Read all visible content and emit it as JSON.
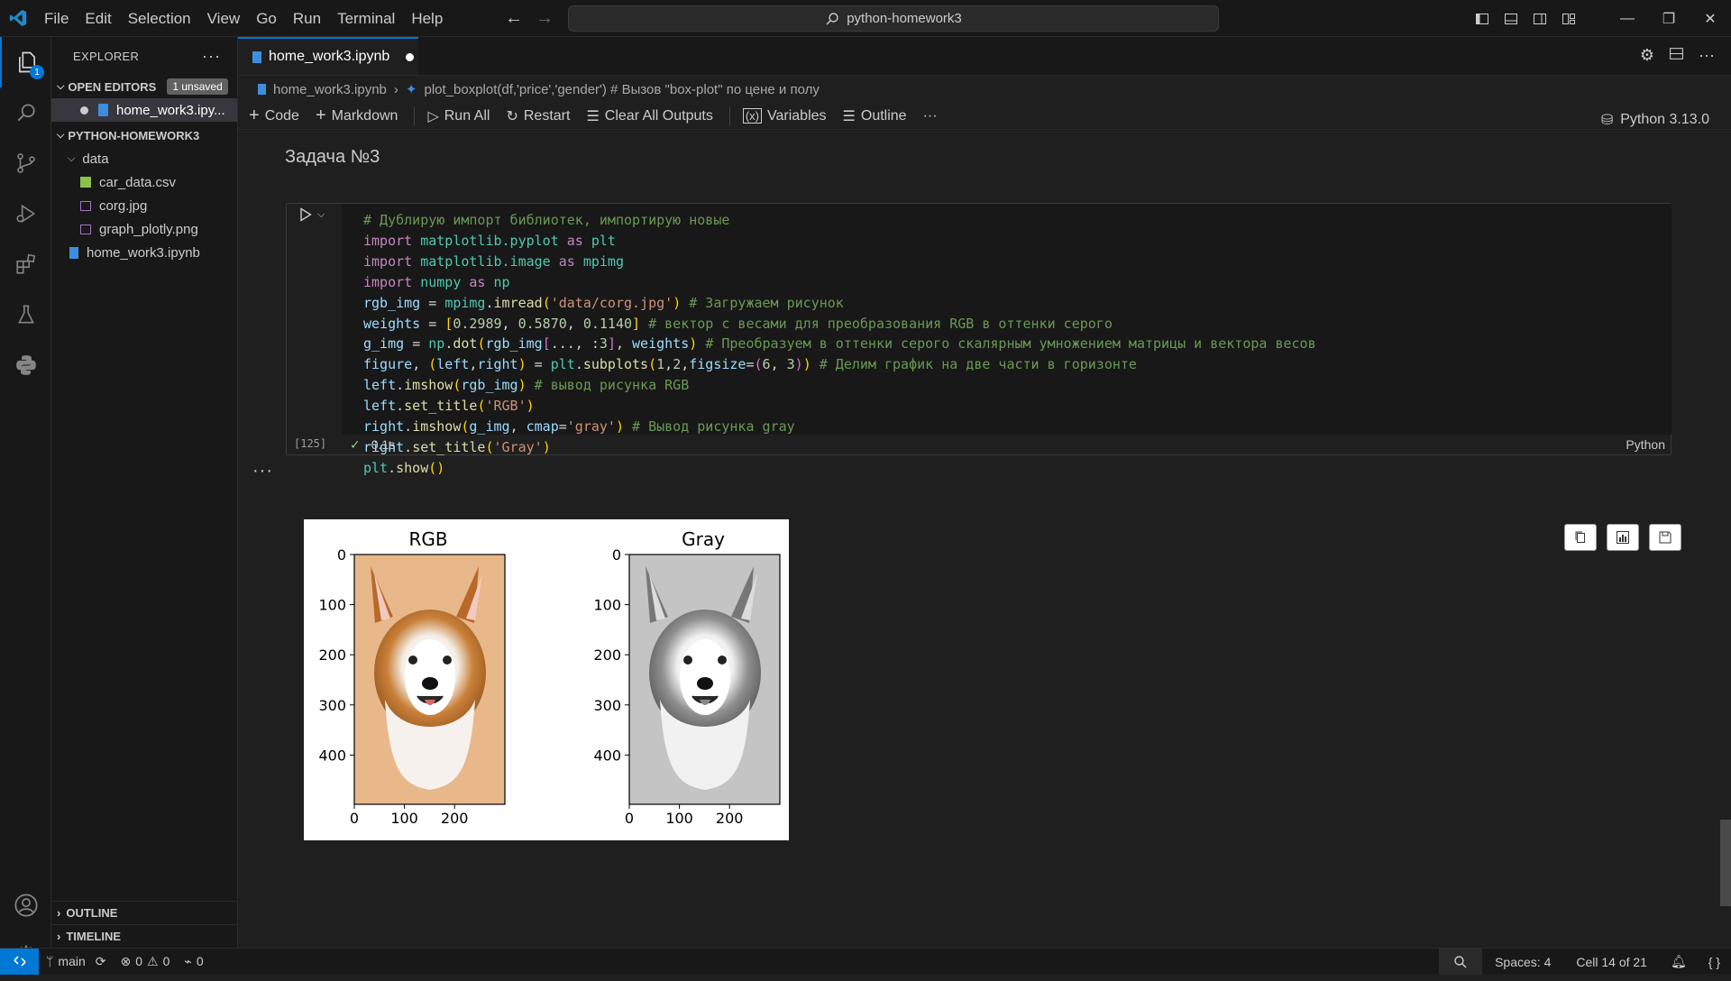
{
  "colors": {
    "accent": "#0078d4",
    "background": "#1f1f1f",
    "sidebar": "#181818",
    "figure_face": "#ffffff"
  },
  "menu": [
    "File",
    "Edit",
    "Selection",
    "View",
    "Go",
    "Run",
    "Terminal",
    "Help"
  ],
  "command_center": {
    "text": "python-homework3"
  },
  "activity_bar": {
    "items": [
      "explorer-icon",
      "search-icon",
      "source-control-icon",
      "run-debug-icon",
      "extensions-icon",
      "testing-icon",
      "python-icon"
    ],
    "explorer_badge": "1",
    "bottom": [
      "accounts-icon",
      "manage-icon"
    ]
  },
  "explorer": {
    "title": "EXPLORER",
    "open_editors": {
      "label": "OPEN EDITORS",
      "badge": "1 unsaved",
      "files": [
        "home_work3.ipy..."
      ]
    },
    "folder": {
      "label": "PYTHON-HOMEWORK3",
      "subfolder": "data",
      "data_files": [
        "car_data.csv",
        "corg.jpg",
        "graph_plotly.png"
      ],
      "root_files": [
        "home_work3.ipynb"
      ]
    },
    "outline": "OUTLINE",
    "timeline": "TIMELINE"
  },
  "tab": {
    "label": "home_work3.ipynb"
  },
  "breadcrumb": {
    "file": "home_work3.ipynb",
    "symbol": "plot_boxplot(df,'price','gender') # Вызов \"box-plot\" по цене и полу"
  },
  "toolbar": {
    "code": "Code",
    "markdown": "Markdown",
    "run_all": "Run All",
    "restart": "Restart",
    "clear_outputs": "Clear All Outputs",
    "variables": "Variables",
    "outline": "Outline",
    "more": "···",
    "kernel": "Python 3.13.0"
  },
  "markdown_cell": {
    "heading": "Задача №3"
  },
  "code_cell": {
    "exec_count": "[125]",
    "status": "0.1s",
    "language": "Python"
  },
  "output": {
    "more": "···",
    "figure": {
      "left_title": "RGB",
      "right_title": "Gray",
      "y_ticks": [
        "0",
        "100",
        "200",
        "300",
        "400"
      ],
      "x_ticks": [
        "0",
        "100",
        "200"
      ]
    }
  },
  "status_bar": {
    "branch": "main",
    "errors": "0",
    "warnings": "0",
    "ports": "0",
    "spaces": "Spaces: 4",
    "cell": "Cell 14 of 21"
  }
}
